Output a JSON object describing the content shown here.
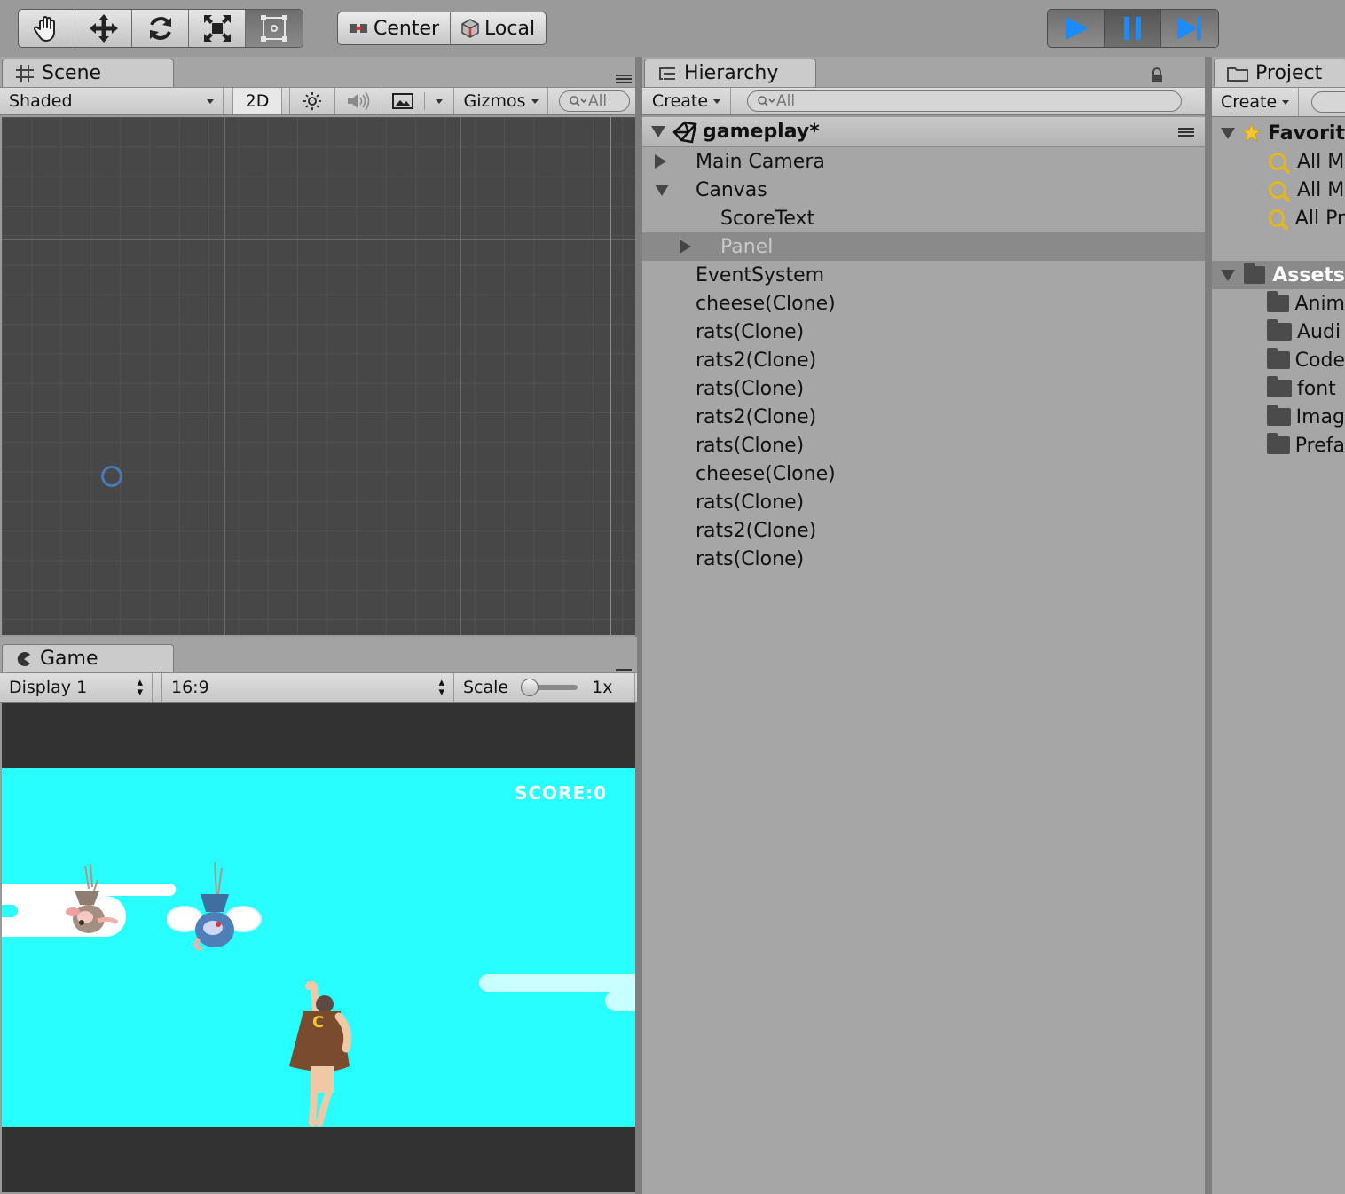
{
  "toolbar": {
    "pivot_center": "Center",
    "pivot_local": "Local"
  },
  "scene": {
    "tab_label": "Scene",
    "shading_mode": "Shaded",
    "mode_2d": "2D",
    "gizmos_label": "Gizmos",
    "search_placeholder": "All"
  },
  "game": {
    "tab_label": "Game",
    "display": "Display 1",
    "aspect": "16:9",
    "scale_label": "Scale",
    "scale_value": "1x",
    "scale_fraction": 0.0,
    "score_text": "SCORE:0",
    "hero_badge": "C"
  },
  "hierarchy": {
    "tab_label": "Hierarchy",
    "create_label": "Create",
    "search_placeholder": "All",
    "scene_name": "gameplay*",
    "items": [
      {
        "label": "Main Camera",
        "depth": 1,
        "expander": "collapsed",
        "selected": false
      },
      {
        "label": "Canvas",
        "depth": 1,
        "expander": "expanded",
        "selected": false
      },
      {
        "label": "ScoreText",
        "depth": 2,
        "expander": "none",
        "selected": false
      },
      {
        "label": "Panel",
        "depth": 2,
        "expander": "collapsed",
        "selected": true
      },
      {
        "label": "EventSystem",
        "depth": 1,
        "expander": "none",
        "selected": false
      },
      {
        "label": "cheese(Clone)",
        "depth": 1,
        "expander": "none",
        "selected": false
      },
      {
        "label": "rats(Clone)",
        "depth": 1,
        "expander": "none",
        "selected": false
      },
      {
        "label": "rats2(Clone)",
        "depth": 1,
        "expander": "none",
        "selected": false
      },
      {
        "label": "rats(Clone)",
        "depth": 1,
        "expander": "none",
        "selected": false
      },
      {
        "label": "rats2(Clone)",
        "depth": 1,
        "expander": "none",
        "selected": false
      },
      {
        "label": "rats(Clone)",
        "depth": 1,
        "expander": "none",
        "selected": false
      },
      {
        "label": "cheese(Clone)",
        "depth": 1,
        "expander": "none",
        "selected": false
      },
      {
        "label": "rats(Clone)",
        "depth": 1,
        "expander": "none",
        "selected": false
      },
      {
        "label": "rats2(Clone)",
        "depth": 1,
        "expander": "none",
        "selected": false
      },
      {
        "label": "rats(Clone)",
        "depth": 1,
        "expander": "none",
        "selected": false
      }
    ]
  },
  "project": {
    "tab_label": "Project",
    "create_label": "Create",
    "favorites_label": "Favorit",
    "favorites": [
      "All M",
      "All M",
      "All Pr"
    ],
    "assets_label": "Assets",
    "folders": [
      "Anim",
      "Audi",
      "Code",
      "font",
      "Imag",
      "Prefa"
    ]
  },
  "colors": {
    "sky": "#29feff",
    "play_blue": "#1a8cff",
    "selection": "#8a8a8a",
    "scene_bg": "#474747"
  }
}
